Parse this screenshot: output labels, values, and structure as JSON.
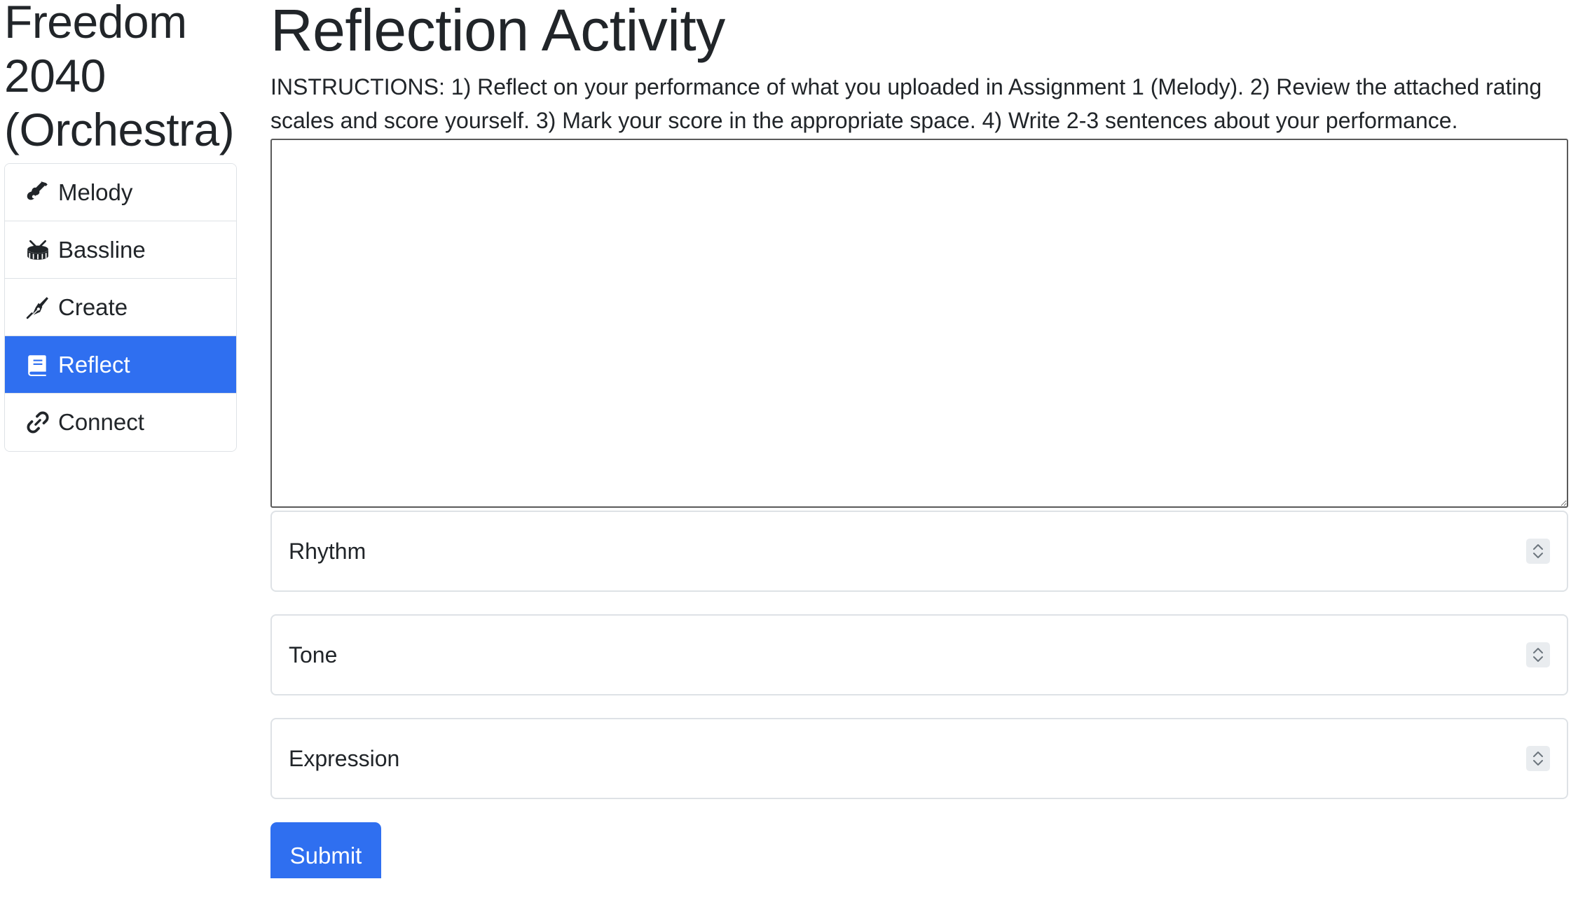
{
  "sidebar": {
    "title_line1": "Freedom",
    "title_line2": "2040",
    "title_line3": "(Orchestra)",
    "items": [
      {
        "label": "Melody",
        "icon": "guitar-icon",
        "active": false
      },
      {
        "label": "Bassline",
        "icon": "drum-icon",
        "active": false
      },
      {
        "label": "Create",
        "icon": "pen-nib-icon",
        "active": false
      },
      {
        "label": "Reflect",
        "icon": "book-icon",
        "active": true
      },
      {
        "label": "Connect",
        "icon": "link-icon",
        "active": false
      }
    ]
  },
  "main": {
    "title": "Reflection Activity",
    "instructions": "INSTRUCTIONS: 1) Reflect on your performance of what you uploaded in Assignment 1 (Melody). 2) Review the attached rating scales and score yourself. 3) Mark your score in the appropriate space. 4) Write 2-3 sentences about your performance.",
    "textarea_value": "",
    "selects": [
      {
        "label": "Rhythm"
      },
      {
        "label": "Tone"
      },
      {
        "label": "Expression"
      }
    ],
    "submit_label": "Submit"
  },
  "colors": {
    "accent": "#2f6ff0",
    "border": "#dee2e6",
    "text": "#212529"
  }
}
